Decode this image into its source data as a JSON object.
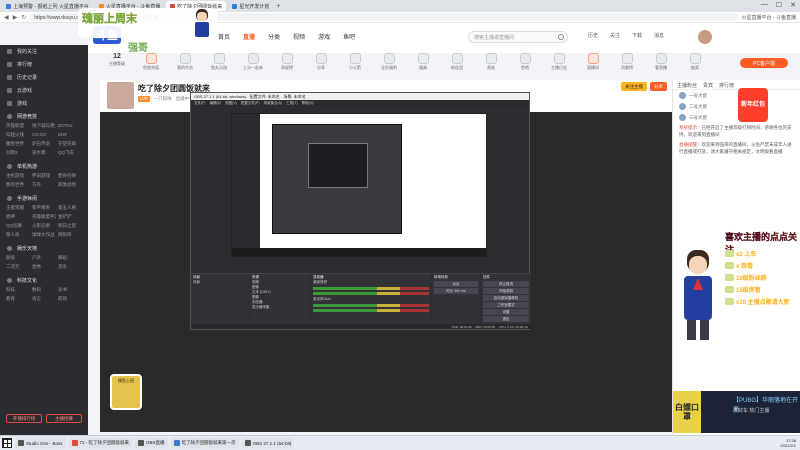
{
  "browser": {
    "tabs": [
      {
        "label": "上海预警 - 报纸上列 火星直播平台",
        "active": false,
        "fav": "blue"
      },
      {
        "label": "火星直播平台 - 斗鱼直播",
        "active": false,
        "fav": "orange"
      },
      {
        "label": "吃了除夕团圆饭就来",
        "active": true,
        "fav": "red"
      },
      {
        "label": "星光开发计划",
        "active": false,
        "fav": "blue"
      }
    ],
    "new_tab": "+",
    "url": "https://www.douyu.com/ 吃了除夕团圆饭就来第一次直播",
    "address_hint": "火星直播平台 - 斗鱼直播",
    "controls": [
      "—",
      "☐",
      "✕"
    ]
  },
  "overlay_sticker": {
    "text": "瑰丽上周末"
  },
  "site": {
    "logo": "斗鱼",
    "logo_sub": "强哥",
    "nav": [
      "首页",
      "直播",
      "分类",
      "视频",
      "游戏",
      "鱼吧"
    ],
    "nav_active": 1,
    "search_placeholder": "搜索主播或直播间",
    "head_icons": [
      "历史",
      "关注",
      "下载",
      "消息"
    ]
  },
  "quick_icons": {
    "first_number": "12",
    "labels": [
      "主播等级",
      "鱼翅充值",
      "我的任务",
      "鱼丸乐园",
      "上分一起来",
      "周星榜",
      "分享",
      "小火箭",
      "全民福利",
      "道具",
      "粉丝团",
      "贵族",
      "鱼吧",
      "主播日志",
      "直播间",
      "贡献榜",
      "看直播",
      "抽奖",
      "红包",
      "更多",
      "活动",
      "设置",
      "帮助"
    ],
    "pc_button": "PC客户端"
  },
  "sidebar": {
    "top_items": [
      "我的关注",
      "排行榜",
      "历史记录",
      "云游戏",
      "游戏"
    ],
    "sections": [
      {
        "title": "网游竞技",
        "items": [
          "英雄联盟",
          "地下城与勇士",
          "DOTA2",
          "穿越火线",
          "CS:GO",
          "DNF",
          "魔兽世界",
          "炉石传说",
          "守望先锋",
          "剑网3",
          "逆水寒",
          "QQ飞车"
        ]
      },
      {
        "title": "单机热游",
        "items": [
          "主机游戏",
          "怀旧游戏",
          "使命召唤",
          "我的世界",
          "方舟",
          "刺激战场"
        ]
      },
      {
        "title": "手游休闲",
        "items": [
          "王者荣耀",
          "和平精英",
          "第五人格",
          "原神",
          "英雄联盟手游",
          "金铲铲",
          "QQ炫舞",
          "火影忍者",
          "明日之后",
          "狼人杀",
          "球球大作战",
          "阴阳师"
        ]
      },
      {
        "title": "娱乐天地",
        "items": [
          "颜值",
          "户外",
          "舞蹈",
          "二次元",
          "星秀",
          "音乐"
        ]
      },
      {
        "title": "科技文化",
        "items": [
          "科技",
          "数码",
          "读书",
          "教育",
          "语言",
          "职场"
        ]
      }
    ],
    "bottom_buttons": [
      "开播排行榜",
      "主播招募"
    ]
  },
  "room": {
    "title": "吃了除夕团圆饭就来",
    "tags": [
      "一只猫咪",
      "直播中",
      "分享生活",
      "星光开发计划",
      "主播招募",
      "热门直播"
    ],
    "level_badge": "LV8",
    "buttons": [
      "关注主播",
      "分享"
    ]
  },
  "obs": {
    "title": "OBS 27.1.1 (64-bit, windows) - 配置文件: 未命名 - 场景: 未命名",
    "menu": [
      "文件(F)",
      "编辑(E)",
      "视图(V)",
      "配置文件(P)",
      "场景集合(S)",
      "工具(T)",
      "帮助(H)"
    ],
    "panels": [
      {
        "title": "场景",
        "rows": [
          "场景"
        ]
      },
      {
        "title": "来源",
        "rows": [
          "视频",
          "图像",
          "文本 (GDI+)",
          "图像",
          "浏览器",
          "显示器采集"
        ]
      },
      {
        "title": "混音器",
        "rows": [
          "桌面音频",
          "麦克风/Aux"
        ]
      },
      {
        "title": "转场特效",
        "rows": [
          "淡出",
          "时长 300 ms"
        ]
      },
      {
        "title": "控件",
        "rows": [
          "停止推流",
          "开始录制",
          "启动虚拟摄像机",
          "工作室模式",
          "设置",
          "退出"
        ]
      }
    ],
    "status": [
      "LIVE: 00:23:45",
      "REC: 00:00:00",
      "CPU: 6.1%, 30.00 fps"
    ]
  },
  "player": {
    "sticker": "摸鱼上班"
  },
  "chat": {
    "tabs": [
      "主播粉丝",
      "贵宾",
      "排行榜"
    ],
    "ranks": [
      "一号大佬",
      "二号大佬",
      "三号大佬"
    ],
    "messages": [
      {
        "user": "系统提示：",
        "text": "已经开启了主播等级打榜时间，感谢各位的支持，欢迎来到直播间"
      },
      {
        "user": "直播提醒：",
        "text": "欢迎来到强哥的直播间，斗鱼严禁未成年人进行直播或打赏，请大家遵守相关规定，文明观看直播"
      }
    ],
    "promo_title": "喜欢主播的点点关注",
    "promo_lines": [
      "x2 上车",
      "x 观看",
      "10级粉丝群",
      "15级房管",
      "x10 主播点歌请大家"
    ],
    "ad_left": "白嫖口罩",
    "ad_title": "【PUBG】华丽落地在开局",
    "ad_text": "发财车 热门主播"
  },
  "side_badge": "新年红包",
  "taskbar": {
    "tasks": [
      "Studio One - Boss",
      "71 - 吃了除夕团圆饭就来",
      "OBS直播",
      "吃了除夕团圆饭就来第一次",
      "OBS 27.1.1 (64-bit)"
    ],
    "time": "17:28",
    "date": "2022/2/1"
  }
}
